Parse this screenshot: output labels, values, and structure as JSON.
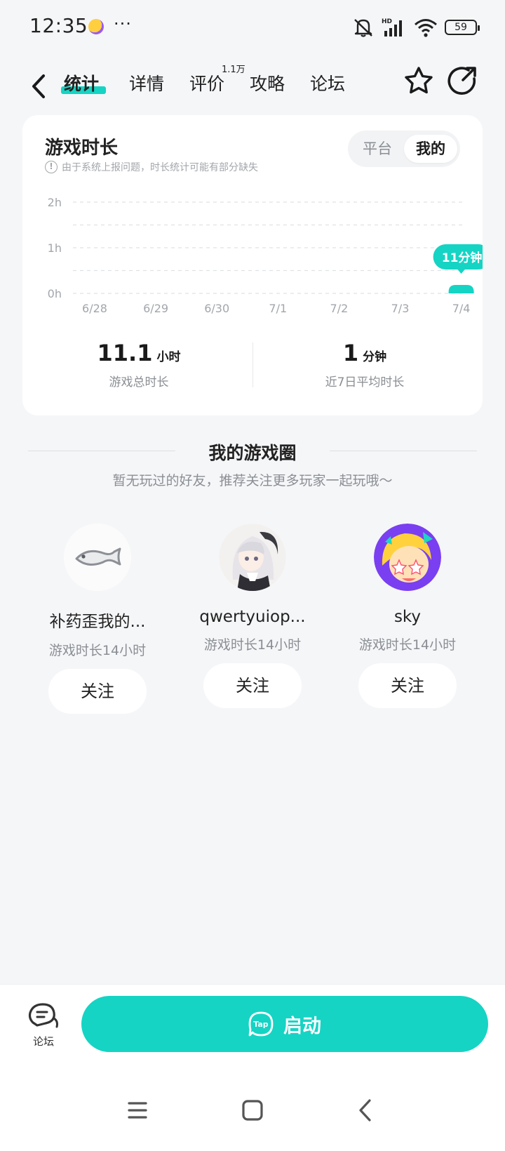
{
  "status_bar": {
    "time": "12:35",
    "more": "···",
    "battery": "59",
    "icons": [
      "app-notification-icon",
      "mute-icon",
      "hd-signal-icon",
      "wifi-icon",
      "battery-icon"
    ]
  },
  "nav": {
    "tabs": [
      {
        "label": "统计",
        "active": true
      },
      {
        "label": "详情",
        "active": false
      },
      {
        "label": "评价",
        "active": false
      },
      {
        "label": "攻略",
        "active": false
      },
      {
        "label": "论坛",
        "active": false
      }
    ],
    "review_badge": "1.1万"
  },
  "playtime_card": {
    "title": "游戏时长",
    "note": "由于系统上报问题，时长统计可能有部分缺失",
    "toggle": {
      "options": [
        "平台",
        "我的"
      ],
      "selected": "我的"
    },
    "total_value": "11.1",
    "total_unit": "小时",
    "total_label": "游戏总时长",
    "avg_value": "1",
    "avg_unit": "分钟",
    "avg_label": "近7日平均时长"
  },
  "chart_data": {
    "type": "bar",
    "categories": [
      "6/28",
      "6/29",
      "6/30",
      "7/1",
      "7/2",
      "7/3",
      "7/4"
    ],
    "values": [
      0,
      0,
      0,
      0,
      0,
      0,
      11
    ],
    "value_unit": "minutes",
    "y_ticks": [
      "2h",
      "1h",
      "0h"
    ],
    "ylim": [
      0,
      120
    ],
    "highlight_label": "11分钟",
    "grid": true,
    "bar_color": "#15d4c4"
  },
  "game_circle": {
    "title": "我的游戏圈",
    "subtitle": "暂无玩过的好友，推荐关注更多玩家一起玩哦～",
    "friends": [
      {
        "name": "补药歪我的...",
        "playtime": "游戏时长14小时",
        "follow": "关注",
        "avatar": "fish-avatar"
      },
      {
        "name": "qwertyuiop...",
        "playtime": "游戏时长14小时",
        "follow": "关注",
        "avatar": "anime-girl-avatar"
      },
      {
        "name": "sky",
        "playtime": "游戏时长14小时",
        "follow": "关注",
        "avatar": "star-eyes-avatar"
      }
    ]
  },
  "bottom_bar": {
    "forum_label": "论坛",
    "launch_label": "启动",
    "launch_logo": "Tap"
  },
  "colors": {
    "accent": "#15d4c4",
    "background": "#f5f6f8",
    "card": "#ffffff"
  }
}
